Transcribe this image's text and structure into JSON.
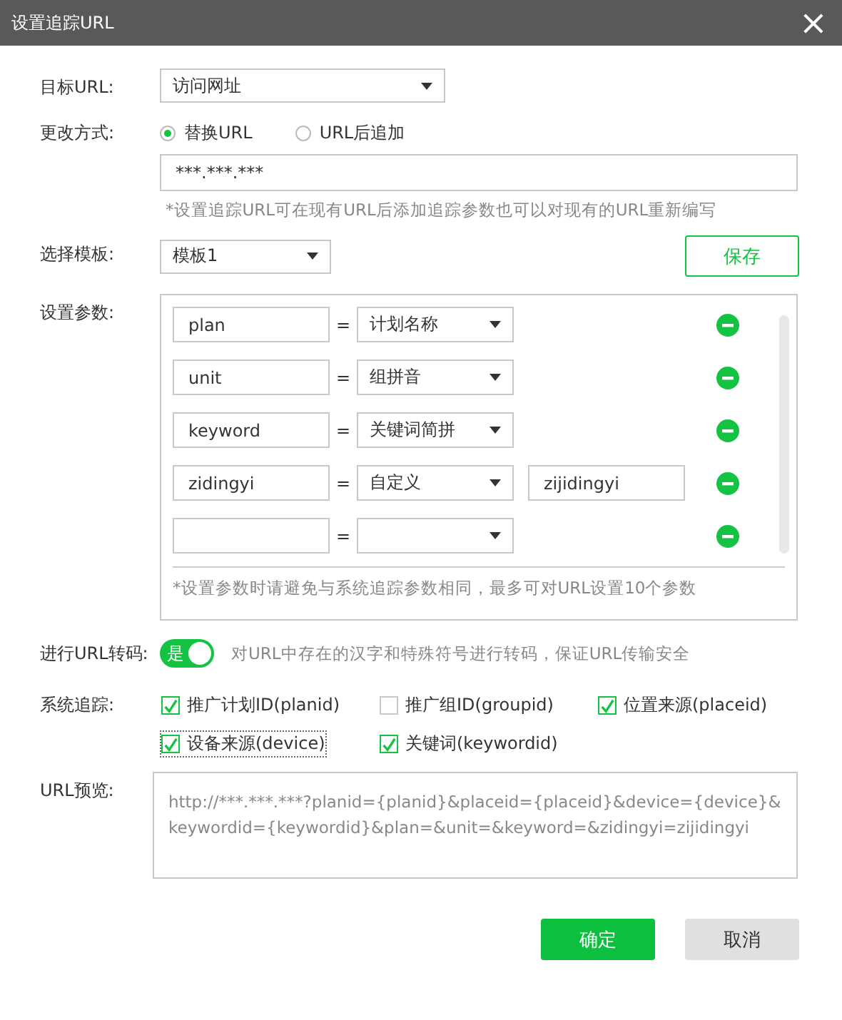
{
  "window": {
    "title": "设置追踪URL",
    "close": "×"
  },
  "target_url": {
    "label": "目标URL:",
    "value": "访问网址"
  },
  "change_mode": {
    "label": "更改方式:",
    "options": [
      {
        "label": "替换URL",
        "selected": true
      },
      {
        "label": "URL后追加",
        "selected": false
      }
    ],
    "url_value": "***.***.***",
    "hint": "*设置追踪URL可在现有URL后添加追踪参数也可以对现有的URL重新编写"
  },
  "template": {
    "label": "选择模板:",
    "value": "模板1",
    "save": "保存"
  },
  "params": {
    "label": "设置参数:",
    "rows": [
      {
        "name": "plan",
        "eq": "=",
        "value": "计划名称"
      },
      {
        "name": "unit",
        "eq": "=",
        "value": "组拼音"
      },
      {
        "name": "keyword",
        "eq": "=",
        "value": "关键词简拼"
      },
      {
        "name": "zidingyi",
        "eq": "=",
        "value": "自定义",
        "custom_value": "zijidingyi"
      },
      {
        "eq": "="
      }
    ],
    "hint": "*设置参数时请避免与系统追踪参数相同，最多可对URL设置10个参数"
  },
  "encode": {
    "label": "进行URL转码:",
    "on": true,
    "toggle_text": "是",
    "hint": "对URL中存在的汉字和特殊符号进行转码，保证URL传输安全"
  },
  "tracking": {
    "label": "系统追踪:",
    "items": [
      {
        "label": "推广计划ID(planid)",
        "checked": true,
        "focused": false
      },
      {
        "label": "推广组ID(groupid)",
        "checked": false,
        "focused": false
      },
      {
        "label": "位置来源(placeid)",
        "checked": true,
        "focused": false
      },
      {
        "label": "设备来源(device)",
        "checked": true,
        "focused": true
      },
      {
        "label": "关键词(keywordid)",
        "checked": true,
        "focused": false
      }
    ]
  },
  "preview": {
    "label": "URL预览:",
    "text": "http://***.***.***?planid={planid}&placeid={placeid}&device={device}&keywordid={keywordid}&plan=&unit=&keyword=&zidingyi=zijidingyi"
  },
  "buttons": [
    {
      "label": "确定",
      "kind": "primary"
    },
    {
      "label": "取消",
      "kind": "secondary"
    }
  ]
}
